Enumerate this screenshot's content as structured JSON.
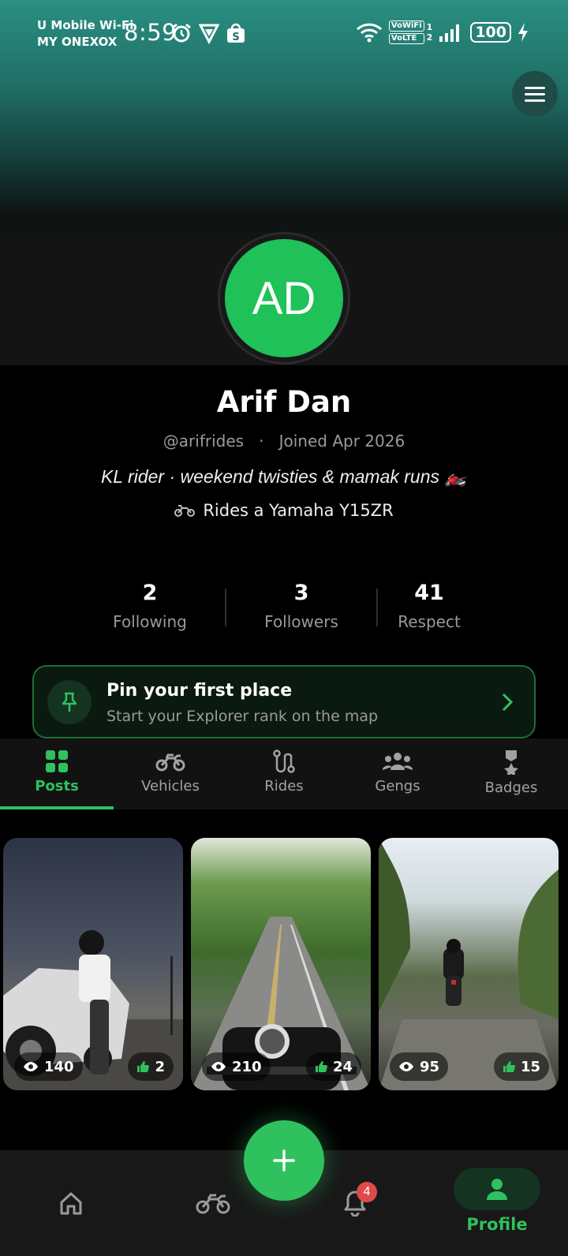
{
  "status_bar": {
    "carrier_line1": "U Mobile Wi-Fi",
    "carrier_line2": "MY ONEXOX",
    "time": "8:59",
    "vowifi": "VoWiFi",
    "volte": "VoLTE",
    "sim1": "1",
    "sim2": "2",
    "battery": "100",
    "icons": [
      "alarm-icon",
      "vpn-icon",
      "shop-icon",
      "wifi-icon",
      "signal-icon",
      "charging-icon"
    ]
  },
  "profile": {
    "initials": "AD",
    "name": "Arif Dan",
    "handle": "@arifrides",
    "joined": "Joined Apr 2026",
    "bio": "KL rider · weekend twisties & mamak runs 🏍️",
    "rides": "Rides a Yamaha Y15ZR",
    "avatar_color": "#1fc158"
  },
  "stats": [
    {
      "value": "2",
      "label": "Following"
    },
    {
      "value": "3",
      "label": "Followers"
    },
    {
      "value": "41",
      "label": "Respect"
    }
  ],
  "pin_card": {
    "title": "Pin your first place",
    "subtitle": "Start your Explorer rank on the map"
  },
  "tabs": [
    {
      "label": "Posts",
      "icon": "grid-icon",
      "active": true
    },
    {
      "label": "Vehicles",
      "icon": "motorbike-icon",
      "active": false
    },
    {
      "label": "Rides",
      "icon": "route-icon",
      "active": false
    },
    {
      "label": "Gengs",
      "icon": "group-icon",
      "active": false
    },
    {
      "label": "Badges",
      "icon": "medal-icon",
      "active": false
    }
  ],
  "posts": [
    {
      "views": "140",
      "likes": "2"
    },
    {
      "views": "210",
      "likes": "24"
    },
    {
      "views": "95",
      "likes": "15"
    }
  ],
  "bottom_nav": {
    "notification_count": "4",
    "profile_label": "Profile"
  },
  "colors": {
    "accent": "#2fc15e",
    "banner": "#2a8f82",
    "notification_badge": "#e14a4a"
  }
}
